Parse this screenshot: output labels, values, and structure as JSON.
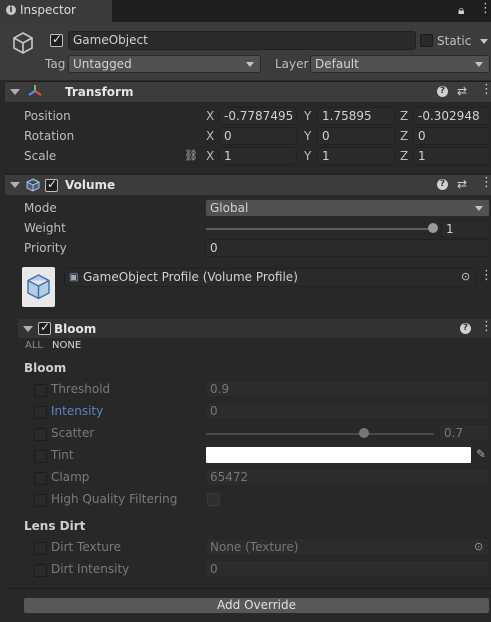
{
  "window": {
    "tab_label": "Inspector"
  },
  "gameobject": {
    "name": "GameObject",
    "static_label": "Static",
    "tag_label": "Tag",
    "tag_value": "Untagged",
    "layer_label": "Layer",
    "layer_value": "Default"
  },
  "transform": {
    "title": "Transform",
    "position_label": "Position",
    "rotation_label": "Rotation",
    "scale_label": "Scale",
    "axis_x": "X",
    "axis_y": "Y",
    "axis_z": "Z",
    "position": {
      "x": "-0.7787495",
      "y": "1.75895",
      "z": "-0.302948"
    },
    "rotation": {
      "x": "0",
      "y": "0",
      "z": "0"
    },
    "scale": {
      "x": "1",
      "y": "1",
      "z": "1"
    }
  },
  "volume": {
    "title": "Volume",
    "mode_label": "Mode",
    "mode_value": "Global",
    "weight_label": "Weight",
    "weight_value": "1",
    "weight_fraction": 1.0,
    "priority_label": "Priority",
    "priority_value": "0",
    "profile_value": "GameObject Profile (Volume Profile)"
  },
  "bloom": {
    "title": "Bloom",
    "all_label": "ALL",
    "none_label": "NONE",
    "section_bloom": "Bloom",
    "threshold_label": "Threshold",
    "threshold_value": "0.9",
    "intensity_label": "Intensity",
    "intensity_value": "0",
    "scatter_label": "Scatter",
    "scatter_value": "0.7",
    "scatter_fraction": 0.7,
    "tint_label": "Tint",
    "tint_color": "#ffffff",
    "clamp_label": "Clamp",
    "clamp_value": "65472",
    "hq_label": "High Quality Filtering",
    "section_lens": "Lens Dirt",
    "dirt_texture_label": "Dirt Texture",
    "dirt_texture_value": "None (Texture)",
    "dirt_intensity_label": "Dirt Intensity",
    "dirt_intensity_value": "0"
  },
  "footer": {
    "add_override_label": "Add Override"
  },
  "colors": {
    "accent_blue": "#5d83c4",
    "panel": "#282828",
    "header": "#3c3c3c"
  }
}
